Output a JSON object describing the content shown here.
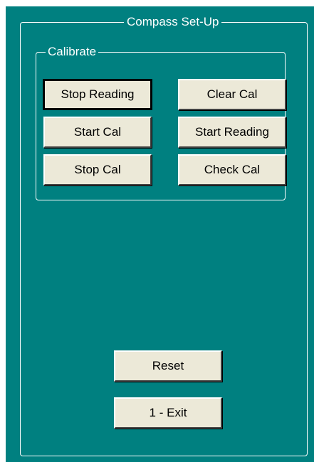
{
  "dialog": {
    "group_title": "Compass Set-Up",
    "calibrate": {
      "group_title": "Calibrate",
      "buttons": {
        "stop_reading": "Stop Reading",
        "clear_cal": "Clear Cal",
        "start_cal": "Start Cal",
        "start_reading": "Start Reading",
        "stop_cal": "Stop Cal",
        "check_cal": "Check Cal"
      }
    },
    "reset_label": "Reset",
    "exit_label": "1 - Exit"
  },
  "colors": {
    "background": "#008080",
    "button_face": "#ece9d8",
    "text": "#ffffff"
  }
}
